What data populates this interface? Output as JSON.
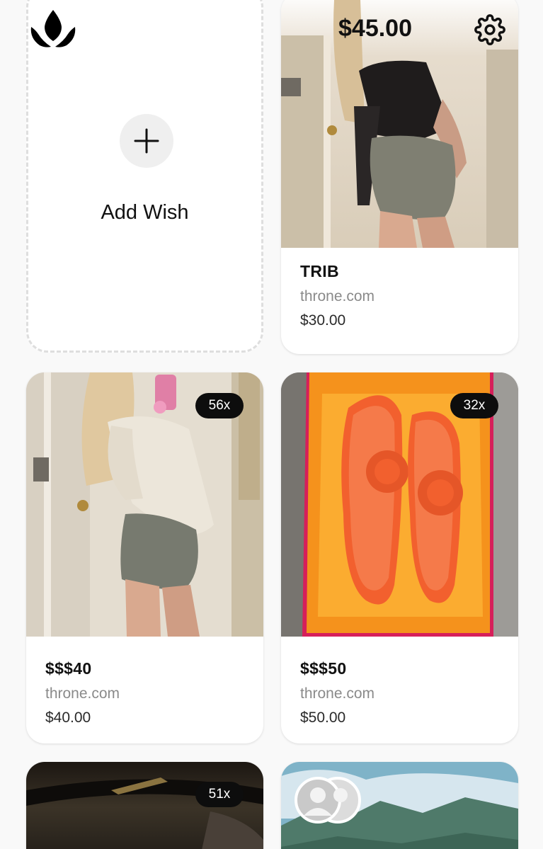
{
  "header": {
    "logo_icon": "crown-logo-icon",
    "balance": "$45.00",
    "settings_icon": "gear-icon"
  },
  "add_wish": {
    "label": "Add Wish",
    "icon": "plus-icon"
  },
  "wishes": [
    {
      "title": "TRIB",
      "site": "throne.com",
      "price": "$30.00",
      "badge": ""
    },
    {
      "title": "$$$40",
      "site": "throne.com",
      "price": "$40.00",
      "badge": "56x"
    },
    {
      "title": "$$$50",
      "site": "throne.com",
      "price": "$50.00",
      "badge": "32x"
    },
    {
      "title": "",
      "site": "",
      "price": "",
      "badge": "51x"
    },
    {
      "title": "",
      "site": "",
      "price": "",
      "badge": "",
      "icon": "group-contribution-icon"
    }
  ],
  "colors": {
    "background": "#f9f9f9",
    "badge": "#0d0d0d",
    "accent_orange": "#f2602e"
  }
}
